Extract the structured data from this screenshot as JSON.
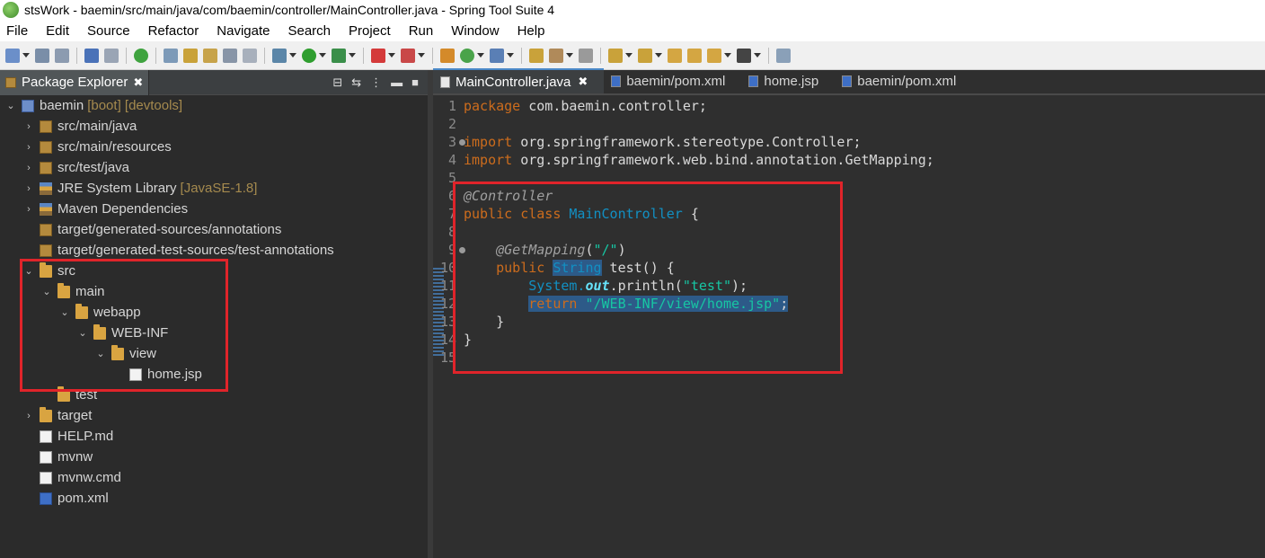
{
  "window": {
    "title": "stsWork - baemin/src/main/java/com/baemin/controller/MainController.java - Spring Tool Suite 4"
  },
  "menu": [
    "File",
    "Edit",
    "Source",
    "Refactor",
    "Navigate",
    "Search",
    "Project",
    "Run",
    "Window",
    "Help"
  ],
  "package_explorer": {
    "tab_label": "Package Explorer",
    "tree": [
      {
        "label": "baemin",
        "decoration": "[boot] [devtools]",
        "depth": 0,
        "icon": "project-icon",
        "expanded": true
      },
      {
        "label": "src/main/java",
        "decoration": "",
        "depth": 1,
        "icon": "package-folder-icon",
        "expanded": false
      },
      {
        "label": "src/main/resources",
        "decoration": "",
        "depth": 1,
        "icon": "package-folder-icon",
        "expanded": false
      },
      {
        "label": "src/test/java",
        "decoration": "",
        "depth": 1,
        "icon": "package-folder-icon",
        "expanded": false
      },
      {
        "label": "JRE System Library",
        "decoration": "[JavaSE-1.8]",
        "depth": 1,
        "icon": "library-icon",
        "expanded": false
      },
      {
        "label": "Maven Dependencies",
        "decoration": "",
        "depth": 1,
        "icon": "library-icon",
        "expanded": false
      },
      {
        "label": "target/generated-sources/annotations",
        "decoration": "",
        "depth": 1,
        "icon": "package-folder-icon",
        "expanded": null
      },
      {
        "label": "target/generated-test-sources/test-annotations",
        "decoration": "",
        "depth": 1,
        "icon": "package-folder-icon",
        "expanded": null
      },
      {
        "label": "src",
        "decoration": "",
        "depth": 1,
        "icon": "folder-icon",
        "expanded": true
      },
      {
        "label": "main",
        "decoration": "",
        "depth": 2,
        "icon": "folder-icon",
        "expanded": true
      },
      {
        "label": "webapp",
        "decoration": "",
        "depth": 3,
        "icon": "folder-icon",
        "expanded": true
      },
      {
        "label": "WEB-INF",
        "decoration": "",
        "depth": 4,
        "icon": "folder-icon",
        "expanded": true
      },
      {
        "label": "view",
        "decoration": "",
        "depth": 5,
        "icon": "folder-icon",
        "expanded": true
      },
      {
        "label": "home.jsp",
        "decoration": "",
        "depth": 6,
        "icon": "file-icon",
        "expanded": null
      },
      {
        "label": "test",
        "decoration": "",
        "depth": 2,
        "icon": "folder-icon",
        "expanded": null
      },
      {
        "label": "target",
        "decoration": "",
        "depth": 1,
        "icon": "folder-icon",
        "expanded": false
      },
      {
        "label": "HELP.md",
        "decoration": "",
        "depth": 1,
        "icon": "file-icon",
        "expanded": null
      },
      {
        "label": "mvnw",
        "decoration": "",
        "depth": 1,
        "icon": "file-icon",
        "expanded": null
      },
      {
        "label": "mvnw.cmd",
        "decoration": "",
        "depth": 1,
        "icon": "file-icon",
        "expanded": null
      },
      {
        "label": "pom.xml",
        "decoration": "",
        "depth": 1,
        "icon": "xml-icon",
        "expanded": null
      }
    ]
  },
  "editor": {
    "tabs": [
      {
        "label": "MainController.java",
        "active": true
      },
      {
        "label": "baemin/pom.xml",
        "active": false
      },
      {
        "label": "home.jsp",
        "active": false
      },
      {
        "label": "baemin/pom.xml",
        "active": false
      }
    ],
    "line_numbers": [
      "1",
      "2",
      "3",
      "4",
      "5",
      "6",
      "7",
      "8",
      "9",
      "10",
      "11",
      "12",
      "13",
      "14",
      "15"
    ],
    "code": {
      "l1_kw": "package",
      "l1_rest": " com.baemin.controller;",
      "l3_kw": "import",
      "l3_rest": " org.springframework.stereotype.Controller;",
      "l4_kw": "import",
      "l4_rest": " org.springframework.web.bind.annotation.GetMapping;",
      "l6_ann": "@Controller",
      "l7_kw": "public class ",
      "l7_cls": "MainController",
      "l7_rest": " {",
      "l9_ann": "@GetMapping",
      "l9_open": "(",
      "l9_str": "\"/\"",
      "l9_close": ")",
      "l10_kw": "public ",
      "l10_type": "String",
      "l10_rest": " test() {",
      "l11_cls": "System.",
      "l11_fld": "out",
      "l11_mid": ".println(",
      "l11_str": "\"test\"",
      "l11_end": ");",
      "l12_kw": "return ",
      "l12_str": "\"/WEB-INF/view/home.jsp\"",
      "l12_end": ";",
      "l13": "}",
      "l14": "}"
    }
  }
}
